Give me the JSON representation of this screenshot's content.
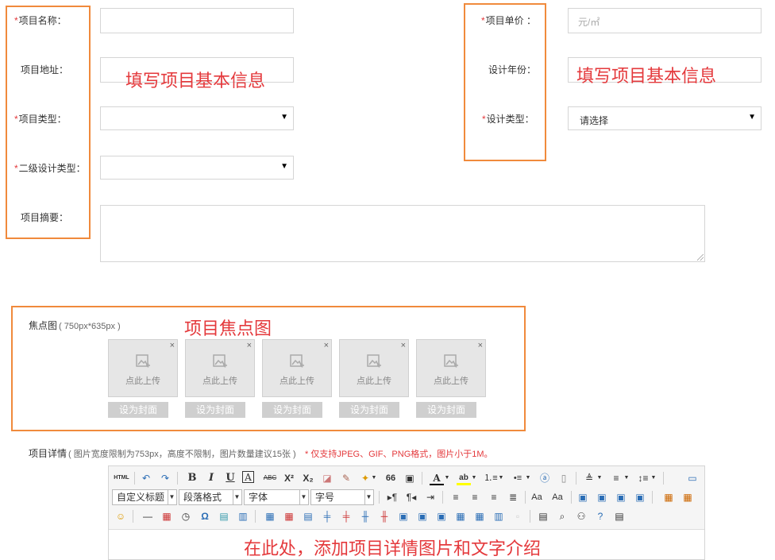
{
  "left_form": {
    "name_label": "项目名称：",
    "address_label": "项目地址：",
    "type_label": "项目类型：",
    "secondary_type_label": "二级设计类型：",
    "summary_label": "项目摘要："
  },
  "right_form": {
    "price_label": "项目单价 ：",
    "price_placeholder": "元/㎡",
    "year_label": "设计年份：",
    "design_type_label": "设计类型：",
    "design_type_value": "请选择"
  },
  "annotations": {
    "left_note": "填写项目基本信息",
    "right_note": "填写项目基本信息",
    "focus_note": "项目焦点图",
    "editor_note": "在此处，添加项目详情图片和文字介绍"
  },
  "required_mark": "*",
  "focus": {
    "label": "焦点图",
    "size_hint": "( 750px*635px )",
    "slots": [
      {
        "upload_text": "点此上传",
        "cover_button": "设为封面"
      },
      {
        "upload_text": "点此上传",
        "cover_button": "设为封面"
      },
      {
        "upload_text": "点此上传",
        "cover_button": "设为封面"
      },
      {
        "upload_text": "点此上传",
        "cover_button": "设为封面"
      },
      {
        "upload_text": "点此上传",
        "cover_button": "设为封面"
      }
    ],
    "close_glyph": "×"
  },
  "details": {
    "label": "项目详情",
    "hint": "( 图片宽度限制为753px，高度不限制，图片数量建议15张 )",
    "format_hint": "* 仅支持JPEG、GIF、PNG格式，图片小于1M。"
  },
  "toolbar": {
    "html": "HTML",
    "bold": "B",
    "italic": "I",
    "underline": "U",
    "font_border": "A",
    "strike": "ABC",
    "superscript": "X²",
    "subscript": "X₂",
    "quote": "66",
    "font_color": "A",
    "custom_heading": "自定义标题",
    "paragraph_format": "段落格式",
    "font_family": "字体",
    "font_size": "字号"
  },
  "colors": {
    "accent_orange": "#f08a3c",
    "note_red": "#e4393c"
  }
}
